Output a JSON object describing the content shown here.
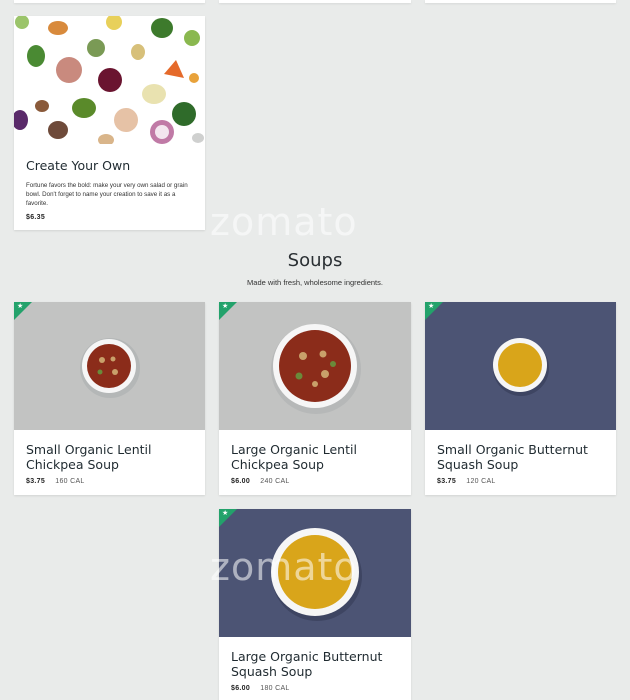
{
  "watermark": "zomato",
  "create_your_own": {
    "title": "Create Your Own",
    "description": "Fortune favors the bold: make your very own salad or grain bowl. Don't forget to name your creation to save it as a favorite.",
    "price": "$6.35"
  },
  "soups_section": {
    "title": "Soups",
    "subtitle": "Made with fresh, wholesome ingredients.",
    "items": [
      {
        "title": "Small Organic Lentil Chickpea Soup",
        "price": "$3.75",
        "calories": "160 CAL"
      },
      {
        "title": "Large Organic Lentil Chickpea Soup",
        "price": "$6.00",
        "calories": "240 CAL"
      },
      {
        "title": "Small Organic Butternut Squash Soup",
        "price": "$3.75",
        "calories": "120 CAL"
      },
      {
        "title": "Large Organic Butternut Squash Soup",
        "price": "$6.00",
        "calories": "180 CAL"
      }
    ]
  },
  "colors": {
    "background": "#e9ebea",
    "ribbon": "#23a26b",
    "lentil_soup": "#8b2c1a",
    "squash_soup": "#d9a51a",
    "wood_bg": "#bfc0bf",
    "blue_bg": "#4c5474"
  },
  "icons": {
    "ribbon": "star-icon"
  }
}
